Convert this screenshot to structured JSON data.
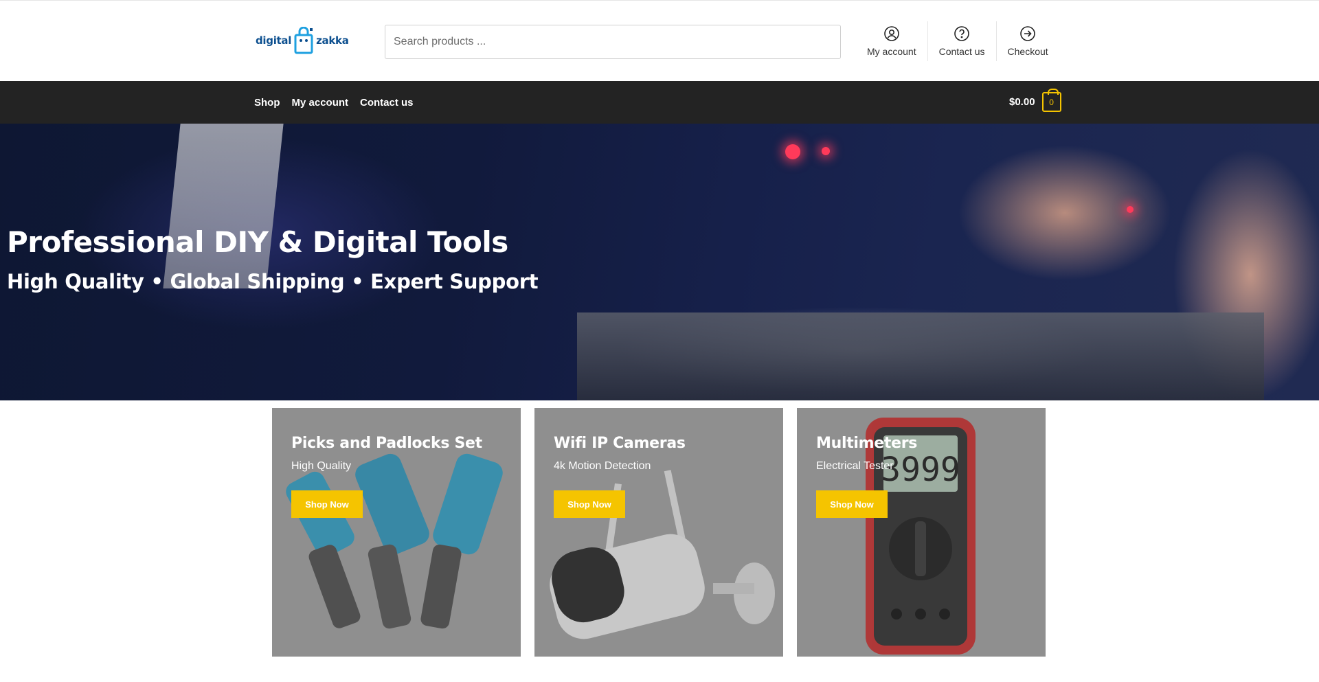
{
  "header": {
    "logo": {
      "left": "digital",
      "right": "zakka"
    },
    "search": {
      "placeholder": "Search products ..."
    },
    "links": [
      {
        "label": "My account",
        "icon": "user-icon"
      },
      {
        "label": "Contact us",
        "icon": "help-icon"
      },
      {
        "label": "Checkout",
        "icon": "arrow-right-circle-icon"
      }
    ]
  },
  "nav": {
    "items": [
      "Shop",
      "My account",
      "Contact us"
    ],
    "cart_total": "$0.00",
    "cart_count": "0"
  },
  "hero": {
    "title": "Professional DIY & Digital Tools",
    "subtitle": "High Quality • Global Shipping • Expert Support"
  },
  "categories": [
    {
      "title": "Picks and Padlocks Set",
      "subtitle": "High Quality",
      "button": "Shop Now"
    },
    {
      "title": "Wifi IP Cameras",
      "subtitle": "4k Motion Detection",
      "button": "Shop Now"
    },
    {
      "title": "Multimeters",
      "subtitle": "Electrical Tester",
      "button": "Shop Now",
      "display": "3999"
    }
  ],
  "colors": {
    "accent": "#f5c400",
    "navbar": "#232323",
    "brand": "#0c4f8f"
  }
}
